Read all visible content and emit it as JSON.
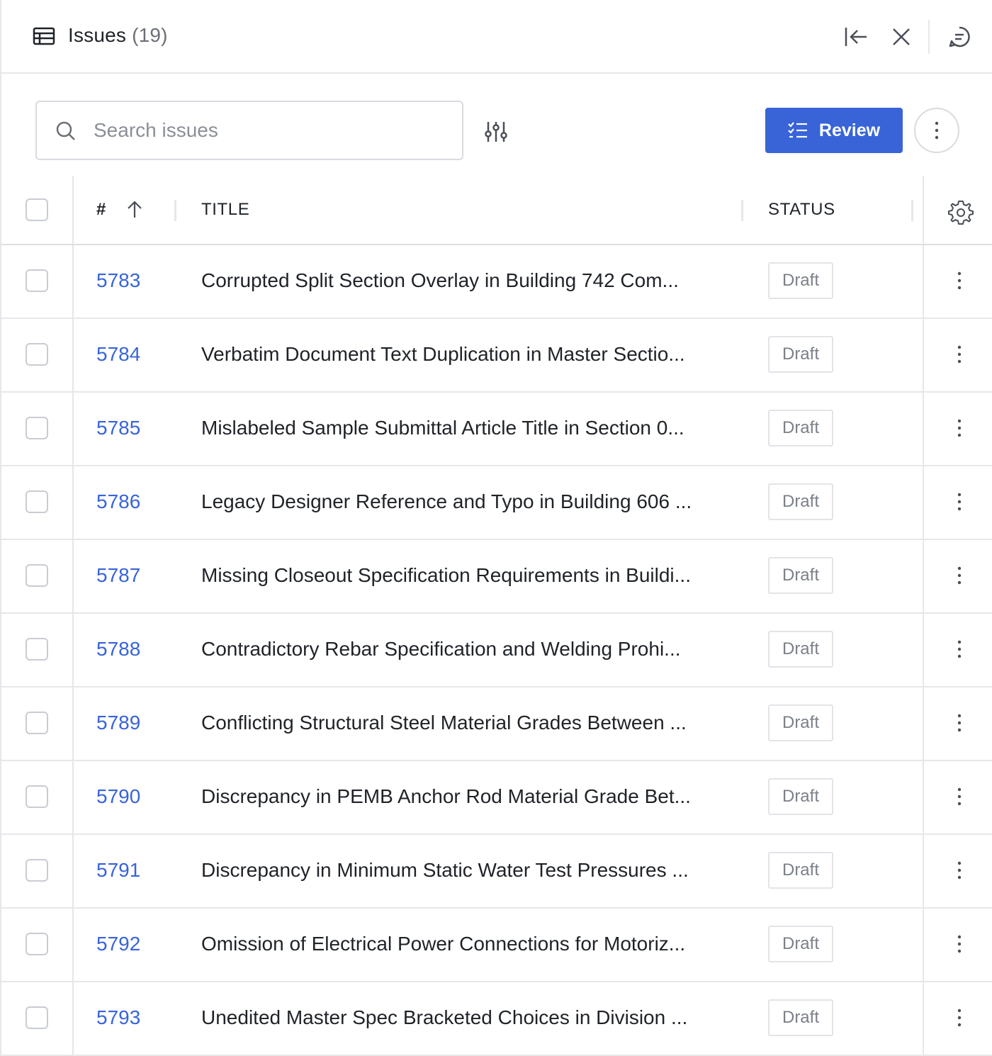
{
  "header": {
    "title": "Issues",
    "count": "(19)",
    "icons": [
      "table-icon",
      "collapse-left-icon",
      "close-icon",
      "comment-icon"
    ]
  },
  "toolbar": {
    "search_placeholder": "Search issues",
    "review_label": "Review"
  },
  "table": {
    "columns": {
      "number": "#",
      "title": "TITLE",
      "status": "STATUS"
    },
    "rows": [
      {
        "number": "5783",
        "title": "Corrupted Split Section Overlay in Building 742 Com...",
        "status": "Draft"
      },
      {
        "number": "5784",
        "title": "Verbatim Document Text Duplication in Master Sectio...",
        "status": "Draft"
      },
      {
        "number": "5785",
        "title": "Mislabeled Sample Submittal Article Title in Section 0...",
        "status": "Draft"
      },
      {
        "number": "5786",
        "title": "Legacy Designer Reference and Typo in Building 606 ...",
        "status": "Draft"
      },
      {
        "number": "5787",
        "title": "Missing Closeout Specification Requirements in Buildi...",
        "status": "Draft"
      },
      {
        "number": "5788",
        "title": "Contradictory Rebar Specification and Welding Prohi...",
        "status": "Draft"
      },
      {
        "number": "5789",
        "title": "Conflicting Structural Steel Material Grades Between ...",
        "status": "Draft"
      },
      {
        "number": "5790",
        "title": "Discrepancy in PEMB Anchor Rod Material Grade Bet...",
        "status": "Draft"
      },
      {
        "number": "5791",
        "title": "Discrepancy in Minimum Static Water Test Pressures ...",
        "status": "Draft"
      },
      {
        "number": "5792",
        "title": "Omission of Electrical Power Connections for Motoriz...",
        "status": "Draft"
      },
      {
        "number": "5793",
        "title": "Unedited Master Spec Bracketed Choices in Division ...",
        "status": "Draft"
      }
    ]
  },
  "colors": {
    "accent": "#3864d8",
    "border": "#e6e7ea",
    "muted": "#7b8089"
  }
}
